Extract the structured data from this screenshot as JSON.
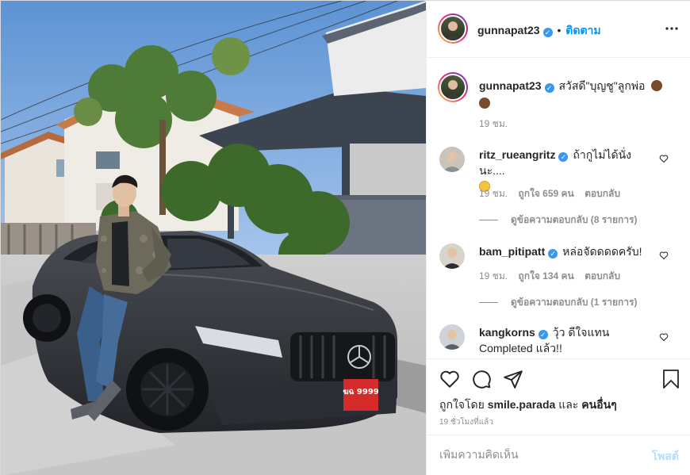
{
  "post": {
    "image_alt": "Man leaning on a matte black Mercedes-AMG in front of a house",
    "plate_text": "ฆฉ 9999"
  },
  "header": {
    "username": "gunnapat23",
    "separator": "•",
    "follow_label": "ติดตาม",
    "more_icon": "more-horizontal-icon"
  },
  "caption": {
    "username": "gunnapat23",
    "text": "สวัสดี\"บุญชู\"ลูกพ่อ",
    "time": "19 ชม."
  },
  "comments": [
    {
      "username": "ritz_rueangritz",
      "text": "ถ้ากูไม่ได้นั่งนะ....",
      "time": "19 ชม.",
      "likes": "ถูกใจ 659 คน",
      "reply_label": "ตอบกลับ",
      "view_replies": "ดูข้อความตอบกลับ (8 รายการ)"
    },
    {
      "username": "bam_pitipatt",
      "text": "หล่อจัดดดดครับ!",
      "time": "19 ชม.",
      "likes": "ถูกใจ 134 คน",
      "reply_label": "ตอบกลับ",
      "view_replies": "ดูข้อความตอบกลับ (1 รายการ)"
    },
    {
      "username": "kangkorns",
      "text": "วุ้ว ดีใจแทน",
      "text2": "Completed แล้ว!!"
    }
  ],
  "actions": {
    "liked_by_prefix": "ถูกใจโดย",
    "liked_by_user": "smile.parada",
    "liked_by_and": "และ",
    "liked_by_others": "คนอื่นๆ",
    "post_time": "19 ชั่วโมงที่แล้ว"
  },
  "add_comment": {
    "placeholder": "เพิ่มความคิดเห็น",
    "post_label": "โพสต์"
  },
  "colors": {
    "accent": "#0095f6",
    "verified": "#3897f0",
    "muted": "#8e8e8e",
    "post_disabled": "#b2dffc"
  }
}
